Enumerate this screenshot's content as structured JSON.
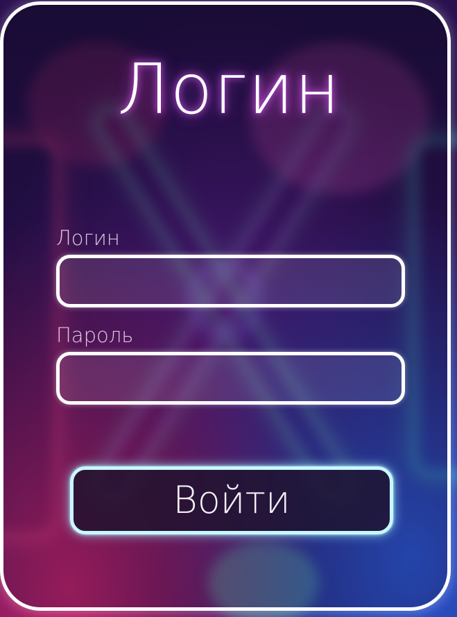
{
  "form": {
    "title": "Логин",
    "login_label": "Логин",
    "login_value": "",
    "password_label": "Пароль",
    "password_value": "",
    "submit_label": "Войти"
  },
  "colors": {
    "card_border": "#ffffff",
    "title_glow": "#e064ff",
    "button_border": "#c8f8ff"
  }
}
